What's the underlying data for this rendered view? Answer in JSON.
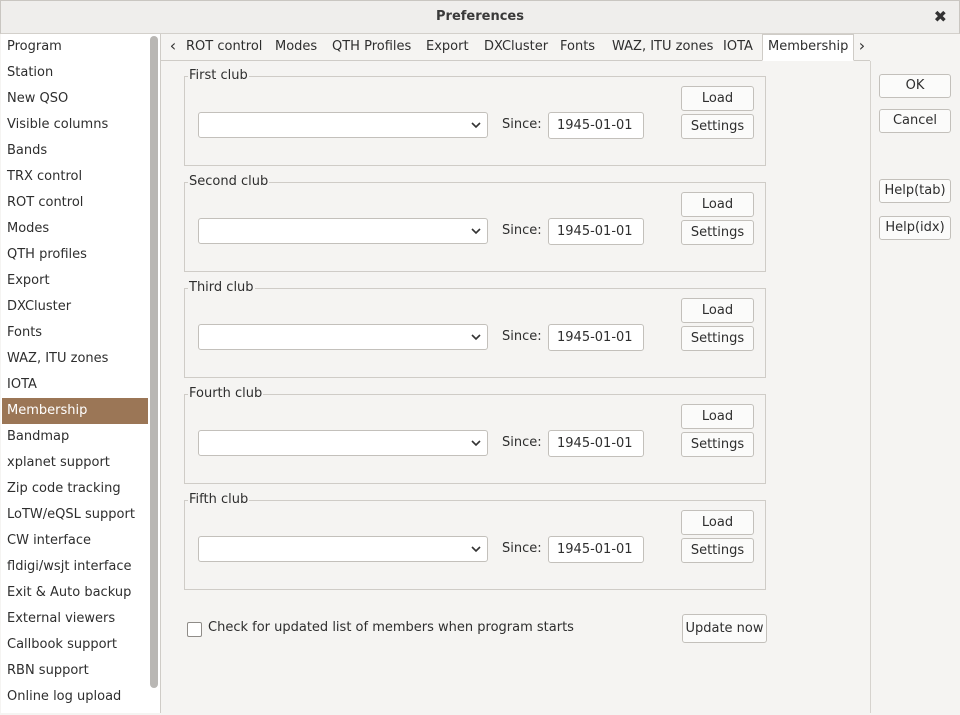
{
  "window": {
    "title": "Preferences",
    "close_glyph": "✖"
  },
  "sidebar": {
    "selected_index": 15,
    "items": [
      "Program",
      "Station",
      "New QSO",
      "Visible columns",
      "Bands",
      "TRX control",
      "ROT control",
      "Modes",
      "QTH profiles",
      "Export",
      "DXCluster",
      "Fonts",
      "WAZ, ITU zones",
      "IOTA",
      "Membership",
      "Bandmap",
      "xplanet support",
      "Zip code tracking",
      "LoTW/eQSL support",
      "CW interface",
      "fldigi/wsjt interface",
      "Exit & Auto backup",
      "External viewers",
      "Callbook support",
      "RBN support",
      "Online log upload"
    ]
  },
  "tabs": {
    "left_arrow": "‹",
    "right_arrow": "›",
    "items": [
      "ROT control",
      "Modes",
      "QTH Profiles",
      "Export",
      "DXCluster",
      "Fonts",
      "WAZ, ITU zones",
      "IOTA",
      "Membership"
    ],
    "active": "Membership"
  },
  "clubs": [
    {
      "title": "First club",
      "since_label": "Since:",
      "since": "1945-01-01",
      "load": "Load",
      "settings": "Settings"
    },
    {
      "title": "Second club",
      "since_label": "Since:",
      "since": "1945-01-01",
      "load": "Load",
      "settings": "Settings"
    },
    {
      "title": "Third club",
      "since_label": "Since:",
      "since": "1945-01-01",
      "load": "Load",
      "settings": "Settings"
    },
    {
      "title": "Fourth club",
      "since_label": "Since:",
      "since": "1945-01-01",
      "load": "Load",
      "settings": "Settings"
    },
    {
      "title": "Fifth club",
      "since_label": "Since:",
      "since": "1945-01-01",
      "load": "Load",
      "settings": "Settings"
    }
  ],
  "check_updates": {
    "label": "Check for updated list of members when program starts",
    "checked": false
  },
  "update_now": "Update now",
  "buttons": {
    "ok": "OK",
    "cancel": "Cancel",
    "help_tab": "Help(tab)",
    "help_idx": "Help(idx)"
  },
  "colors": {
    "selection": "#9b7656",
    "window_bg": "#f5f4f2"
  }
}
